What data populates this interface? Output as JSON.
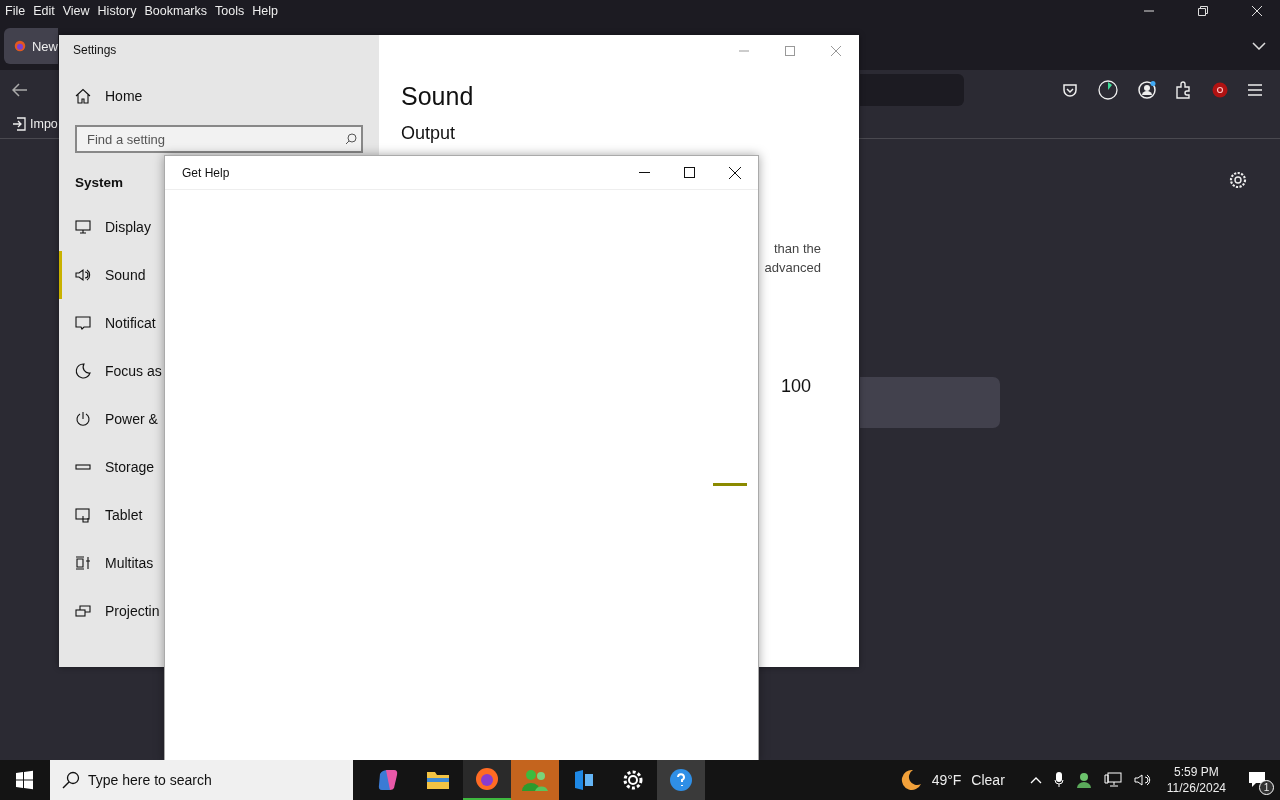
{
  "browser": {
    "menu": [
      "File",
      "Edit",
      "View",
      "History",
      "Bookmarks",
      "Tools",
      "Help"
    ],
    "tab": {
      "title": "New"
    },
    "bookmark": "Impo"
  },
  "settings": {
    "title": "Settings",
    "home": "Home",
    "search": {
      "placeholder": "Find a setting"
    },
    "section": "System",
    "nav": [
      {
        "label": "Display",
        "selected": false
      },
      {
        "label": "Sound",
        "selected": true
      },
      {
        "label": "Notificat",
        "selected": false
      },
      {
        "label": "Focus as",
        "selected": false
      },
      {
        "label": "Power &",
        "selected": false
      },
      {
        "label": "Storage",
        "selected": false
      },
      {
        "label": "Tablet",
        "selected": false
      },
      {
        "label": "Multitas",
        "selected": false
      },
      {
        "label": "Projectin",
        "selected": false
      }
    ],
    "page_title": "Sound",
    "subheading": "Output",
    "text_lines": [
      "than the",
      "advanced"
    ],
    "volume": "100"
  },
  "help": {
    "title": "Get Help"
  },
  "taskbar": {
    "search": {
      "placeholder": "Type here to search"
    },
    "weather": {
      "temp": "49°F",
      "condition": "Clear"
    },
    "time": "5:59 PM",
    "date": "11/26/2024",
    "notifications": "1"
  }
}
